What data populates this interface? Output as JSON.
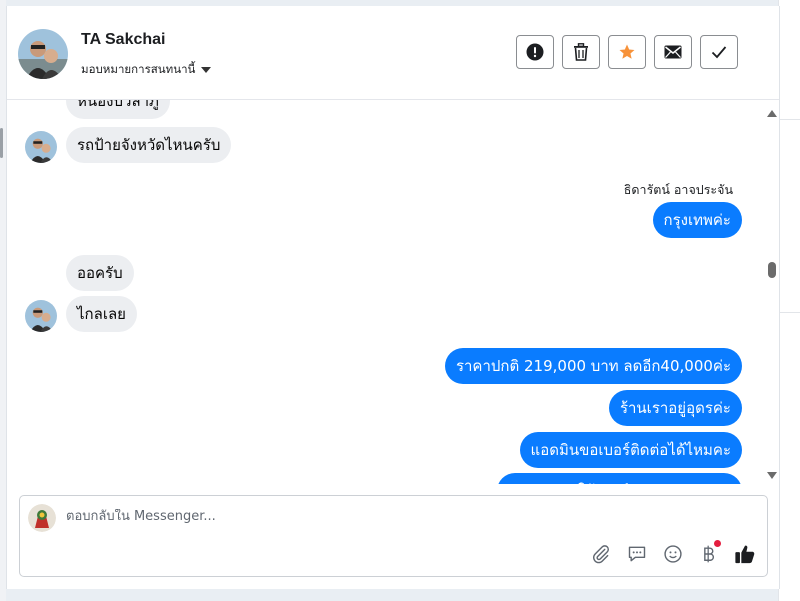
{
  "header": {
    "name": "TA Sakchai",
    "assign_label": "มอบหมายการสนทนานี้",
    "actions": [
      "mark-spam",
      "delete",
      "star",
      "mark-unread",
      "done"
    ]
  },
  "messages": {
    "top_partial": "หนองบัวลำภู",
    "m1": "รถป้ายจังหวัดไหนครับ",
    "sender": "ธิดารัตน์ อาจประจัน",
    "m2": "กรุงเทพค่ะ",
    "m3": "ออครับ",
    "m4": "ไกลเลย",
    "m5": "ราคาปกติ 219,000 บาท ลดอีก40,000ค่ะ",
    "m6": "ร้านเราอยู่อุดรค่ะ",
    "m7": "แอดมินขอเบอร์ติดต่อได้ไหมคะ",
    "m8_partial": "ขออนุญาตให้เซลส์ติดต่อกลับนะคะ"
  },
  "composer": {
    "placeholder": "ตอบกลับใน Messenger...",
    "tools": [
      "attach-icon",
      "saved-replies-icon",
      "emoji-icon",
      "baht-icon",
      "like-icon"
    ]
  },
  "colors": {
    "outgoing_bubble": "#0a7cff",
    "incoming_bubble": "#eceef1",
    "star": "#f7923a",
    "notification_dot": "#e41e3f"
  }
}
